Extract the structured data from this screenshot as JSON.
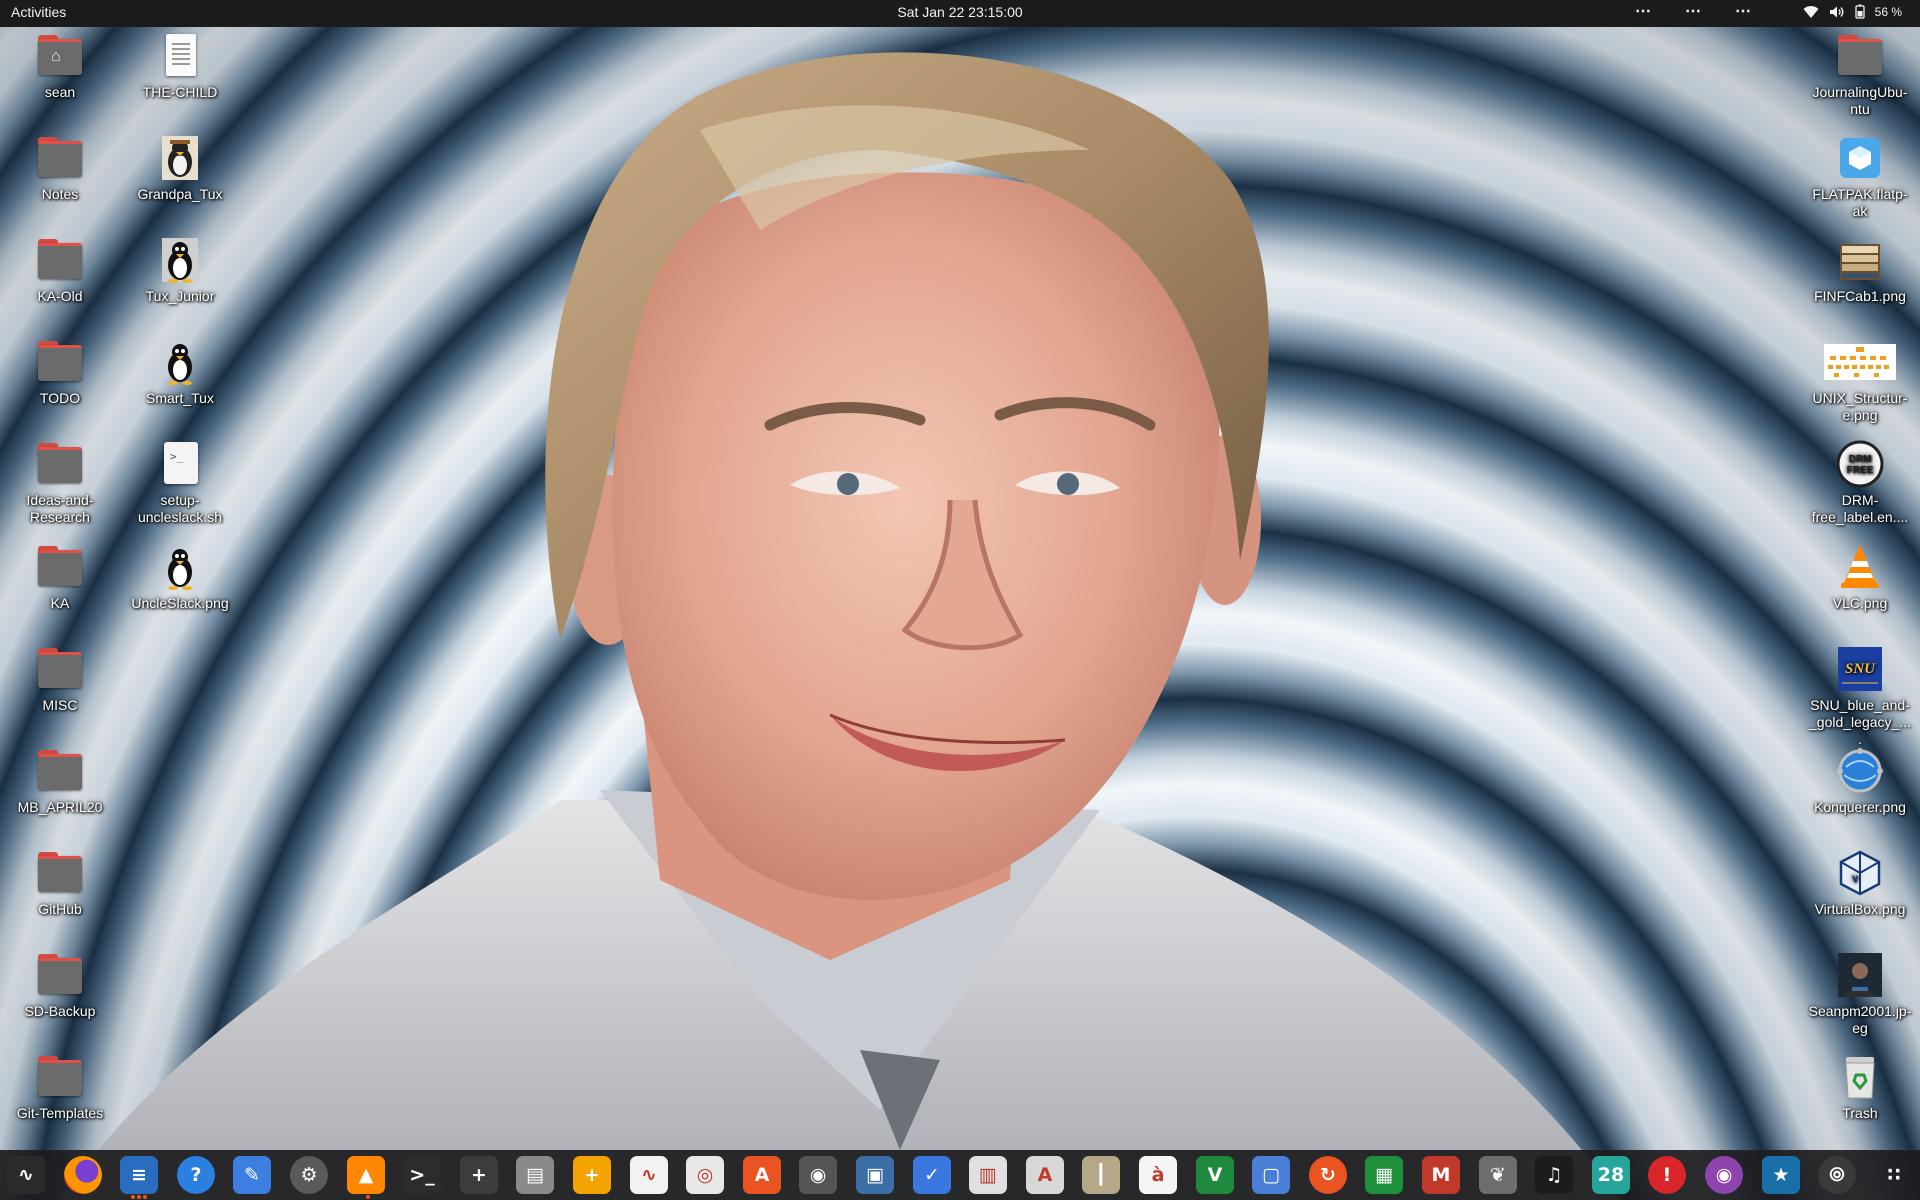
{
  "topbar": {
    "activities": "Activities",
    "clock": "Sat Jan 22  23:15:00",
    "indicator_menus": [
      "⋯",
      "⋯",
      "⋯"
    ],
    "battery": "56 %",
    "icons": [
      "wifi-icon",
      "volume-icon",
      "battery-icon"
    ]
  },
  "desktop": {
    "left_column": [
      {
        "label": "sean",
        "kind": "home-folder"
      },
      {
        "label": "Notes",
        "kind": "folder"
      },
      {
        "label": "KA-Old",
        "kind": "folder"
      },
      {
        "label": "TODO",
        "kind": "folder"
      },
      {
        "label": "Ideas-and-Research",
        "kind": "folder"
      },
      {
        "label": "KA",
        "kind": "folder"
      },
      {
        "label": "MISC",
        "kind": "folder"
      },
      {
        "label": "MB_APRIL20",
        "kind": "folder"
      },
      {
        "label": "GitHub",
        "kind": "folder"
      },
      {
        "label": "SD-Backup",
        "kind": "folder"
      },
      {
        "label": "Git-Templates",
        "kind": "folder"
      }
    ],
    "second_column": [
      {
        "label": "THE-CHILD",
        "kind": "text-document"
      },
      {
        "label": "Grandpa_Tux",
        "kind": "image-tux-grandpa"
      },
      {
        "label": "Tux_Junior",
        "kind": "image-tux"
      },
      {
        "label": "Smart_Tux",
        "kind": "image-tux"
      },
      {
        "label": "setup-uncleslack.sh",
        "kind": "shell-script"
      },
      {
        "label": "UncleSlack.png",
        "kind": "image-tux"
      }
    ],
    "right_column": [
      {
        "label": "JournalingUbu-ntu",
        "kind": "folder"
      },
      {
        "label": "FLATPAK.flatp-ak",
        "kind": "flatpak-package"
      },
      {
        "label": "FINFCab1.png",
        "kind": "image-cabinet"
      },
      {
        "label": "UNIX_Structur-e.png",
        "kind": "image-diagram"
      },
      {
        "label": "DRM-free_label.en....",
        "kind": "image-drm-free"
      },
      {
        "label": "VLC.png",
        "kind": "image-vlc"
      },
      {
        "label": "SNU_blue_and-_gold_legacy_....",
        "kind": "image-snu"
      },
      {
        "label": "Konquerer.png",
        "kind": "image-konqueror"
      },
      {
        "label": "VirtualBox.png",
        "kind": "image-virtualbox"
      },
      {
        "label": "Seanpm2001.jp-eg",
        "kind": "image-photo"
      },
      {
        "label": "Trash",
        "kind": "trash"
      }
    ]
  },
  "dock": {
    "apps": [
      {
        "name": "system-monitor-icon",
        "glyph": "∿",
        "color": "#2b2b2b"
      },
      {
        "name": "firefox-icon",
        "glyph": "",
        "color": "#e66000"
      },
      {
        "name": "libreoffice-writer-icon",
        "glyph": "≡",
        "color": "#2a6cbf"
      },
      {
        "name": "help-icon",
        "glyph": "?",
        "color": "#2a7fe0"
      },
      {
        "name": "text-editor-icon",
        "glyph": "✎",
        "color": "#3d7ee0"
      },
      {
        "name": "settings-icon",
        "glyph": "⚙",
        "color": "#5a5a5a"
      },
      {
        "name": "vlc-icon",
        "glyph": "▲",
        "color": "#ff8800"
      },
      {
        "name": "terminal-icon",
        "glyph": ">_",
        "color": "#2c2c2c"
      },
      {
        "name": "calculator-icon",
        "glyph": "+",
        "color": "#3c3c3c"
      },
      {
        "name": "files-icon",
        "glyph": "▤",
        "color": "#8a8a8a"
      },
      {
        "name": "spreadsheet-calc-icon",
        "glyph": "+",
        "color": "#f4a400"
      },
      {
        "name": "gnuplot-graph-icon",
        "glyph": "∿",
        "color": "#f2f2f2"
      },
      {
        "name": "image-viewer-icon",
        "glyph": "◎",
        "color": "#e8e8e8"
      },
      {
        "name": "software-center-icon",
        "glyph": "A",
        "color": "#e95420"
      },
      {
        "name": "disc-burner-icon",
        "glyph": "◉",
        "color": "#555555"
      },
      {
        "name": "remote-desktop-icon",
        "glyph": "▣",
        "color": "#3a6ea5"
      },
      {
        "name": "task-checklist-icon",
        "glyph": "✓",
        "color": "#3a78e0"
      },
      {
        "name": "document-scanner-icon",
        "glyph": "▥",
        "color": "#e0e0e0"
      },
      {
        "name": "font-viewer-icon",
        "glyph": "A",
        "color": "#d8d8d8"
      },
      {
        "name": "archive-manager-icon",
        "glyph": "┃",
        "color": "#b5a888"
      },
      {
        "name": "character-map-icon",
        "glyph": "à",
        "color": "#f5f5f5"
      },
      {
        "name": "vim-icon",
        "glyph": "V",
        "color": "#1f8a3e"
      },
      {
        "name": "screenshot-icon",
        "glyph": "▢",
        "color": "#4a7fd8"
      },
      {
        "name": "backup-icon",
        "glyph": "↻",
        "color": "#e95420"
      },
      {
        "name": "spreadsheet-icon",
        "glyph": "▦",
        "color": "#1e8f3a"
      },
      {
        "name": "mario-game-icon",
        "glyph": "M",
        "color": "#c0392b"
      },
      {
        "name": "gimp-icon",
        "glyph": "❦",
        "color": "#6d6d6d"
      },
      {
        "name": "music-player-icon",
        "glyph": "♫",
        "color": "#1c1c1c"
      },
      {
        "name": "calendar-icon",
        "glyph": "28",
        "color": "#26a69a"
      },
      {
        "name": "update-notifier-icon",
        "glyph": "!",
        "color": "#d9262b"
      },
      {
        "name": "webcam-icon",
        "glyph": "◉",
        "color": "#8e44ad"
      },
      {
        "name": "network-tool-icon",
        "glyph": "★",
        "color": "#1a6fa8"
      },
      {
        "name": "ubuntu-settings-icon",
        "glyph": "⦾",
        "color": "#3a3a3a"
      },
      {
        "name": "show-apps-icon",
        "glyph": "∷",
        "color": "transparent"
      }
    ]
  }
}
